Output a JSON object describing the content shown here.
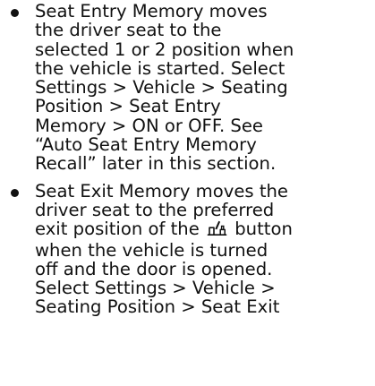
{
  "bullets": [
    {
      "lines": [
        "Seat Entry Memory moves",
        "the driver seat to the",
        "selected 1 or 2 position when",
        "the vehicle is started. Select",
        "Settings > Vehicle > Seating",
        "Position > Seat Entry",
        "Memory > ON or OFF. See",
        "“Auto Seat Entry Memory",
        "Recall” later in this section."
      ]
    },
    {
      "lines": [
        "Seat Exit Memory moves the",
        "driver seat to the preferred"
      ],
      "icon_line": {
        "before": "exit position of the",
        "icon": "seat-exit-icon",
        "after": "button"
      },
      "lines_after": [
        "when the vehicle is turned",
        "off and the door is opened.",
        "Select Settings > Vehicle >",
        "Seating Position > Seat Exit"
      ]
    }
  ]
}
